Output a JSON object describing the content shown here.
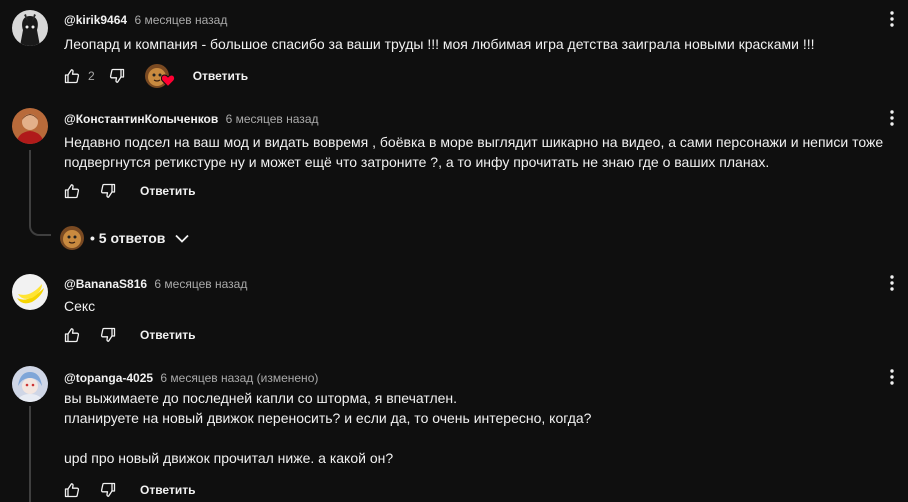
{
  "comments": [
    {
      "author": "@kirik9464",
      "time": "6 месяцев назад",
      "text": "Леопард и компания - большое спасибо за ваши труды !!! моя любимая игра детства заиграла новыми красками !!!",
      "likes": "2",
      "reply_label": "Ответить"
    },
    {
      "author": "@КонстантинКолыченков",
      "time": "6 месяцев назад",
      "text": "Недавно подсел на ваш мод и видать вовремя , боёвка в море выглядит шикарно на видео, а сами персонажи и неписи тоже\nподвергнутся ретикстуре ну и может ещё что затроните ?, а то инфу прочитать не знаю где о ваших планах.",
      "reply_label": "Ответить",
      "replies_label": "• 5 ответов"
    },
    {
      "author": "@BananaS816",
      "time": "6 месяцев назад",
      "text": "Секс",
      "reply_label": "Ответить"
    },
    {
      "author": "@topanga-4025",
      "time": "6 месяцев назад (изменено)",
      "text": "вы выжимаете до последней капли со шторма, я впечатлен.\nпланируете на новый движок переносить? и если да, то очень интересно, когда?\n\nupd про новый движок прочитал ниже. а какой он?",
      "reply_label": "Ответить"
    }
  ],
  "colors": {
    "bg": "#0f0f0f",
    "text": "#f1f1f1",
    "secondary": "#aaaaaa",
    "heart": "#ff0033"
  },
  "icons": [
    "like-icon",
    "dislike-icon",
    "more-vert-icon",
    "chevron-down-icon",
    "heart-icon"
  ]
}
